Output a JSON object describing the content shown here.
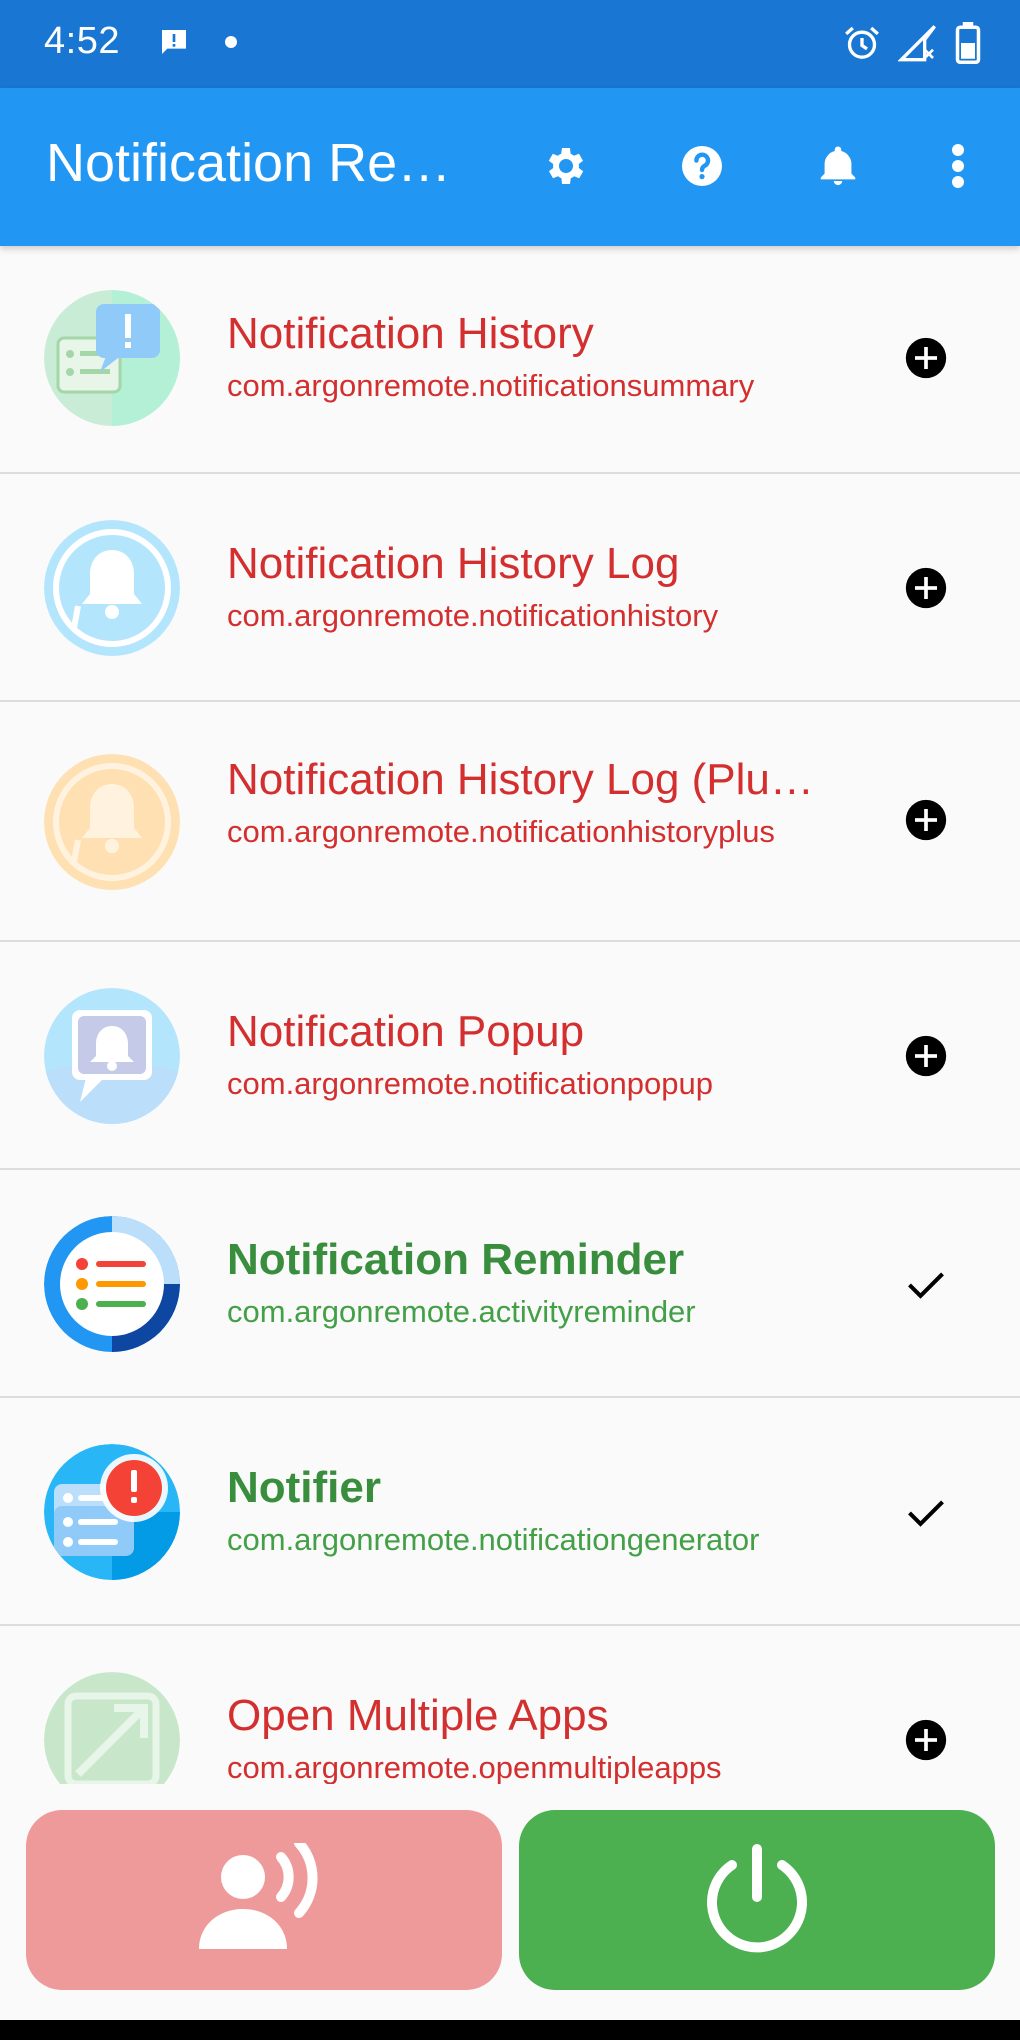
{
  "status_bar": {
    "time": "4:52",
    "left_icons": [
      "message-alert-icon",
      "dot-icon"
    ],
    "right_icons": [
      "alarm-icon",
      "signal-icon",
      "battery-icon"
    ]
  },
  "app_bar": {
    "title": "Notification Re…",
    "full_title": "Notification Re",
    "actions": [
      "settings-icon",
      "help-icon",
      "bell-icon",
      "more-vert-icon"
    ]
  },
  "colors": {
    "status_bar": "#1976d2",
    "app_bar": "#2196f3",
    "not_installed_text": "#d32f2f",
    "installed_text": "#388e3c",
    "left_button": "#ef9a9a",
    "right_button": "#4caf50"
  },
  "apps": [
    {
      "name": "Notification History",
      "package": "com.argonremote.notificationsummary",
      "installed": false,
      "icon": "notification-history-app-icon",
      "action_icon": "add-circle-icon"
    },
    {
      "name": "Notification History Log",
      "package": "com.argonremote.notificationhistory",
      "installed": false,
      "icon": "notification-history-log-app-icon",
      "action_icon": "add-circle-icon"
    },
    {
      "name": "Notification History Log (Plu…",
      "package": "com.argonremote.notificationhistoryplus",
      "installed": false,
      "icon": "notification-history-log-plus-app-icon",
      "action_icon": "add-circle-icon"
    },
    {
      "name": "Notification Popup",
      "package": "com.argonremote.notificationpopup",
      "installed": false,
      "icon": "notification-popup-app-icon",
      "action_icon": "add-circle-icon"
    },
    {
      "name": "Notification Reminder",
      "package": "com.argonremote.activityreminder",
      "installed": true,
      "icon": "notification-reminder-app-icon",
      "action_icon": "check-icon"
    },
    {
      "name": "Notifier",
      "package": "com.argonremote.notificationgenerator",
      "installed": true,
      "icon": "notifier-app-icon",
      "action_icon": "check-icon"
    },
    {
      "name": "Open Multiple Apps",
      "package": "com.argonremote.openmultipleapps",
      "installed": false,
      "icon": "open-multiple-apps-app-icon",
      "action_icon": "add-circle-icon"
    }
  ],
  "bottom_buttons": {
    "left": "voice-person-icon",
    "right": "power-icon"
  }
}
